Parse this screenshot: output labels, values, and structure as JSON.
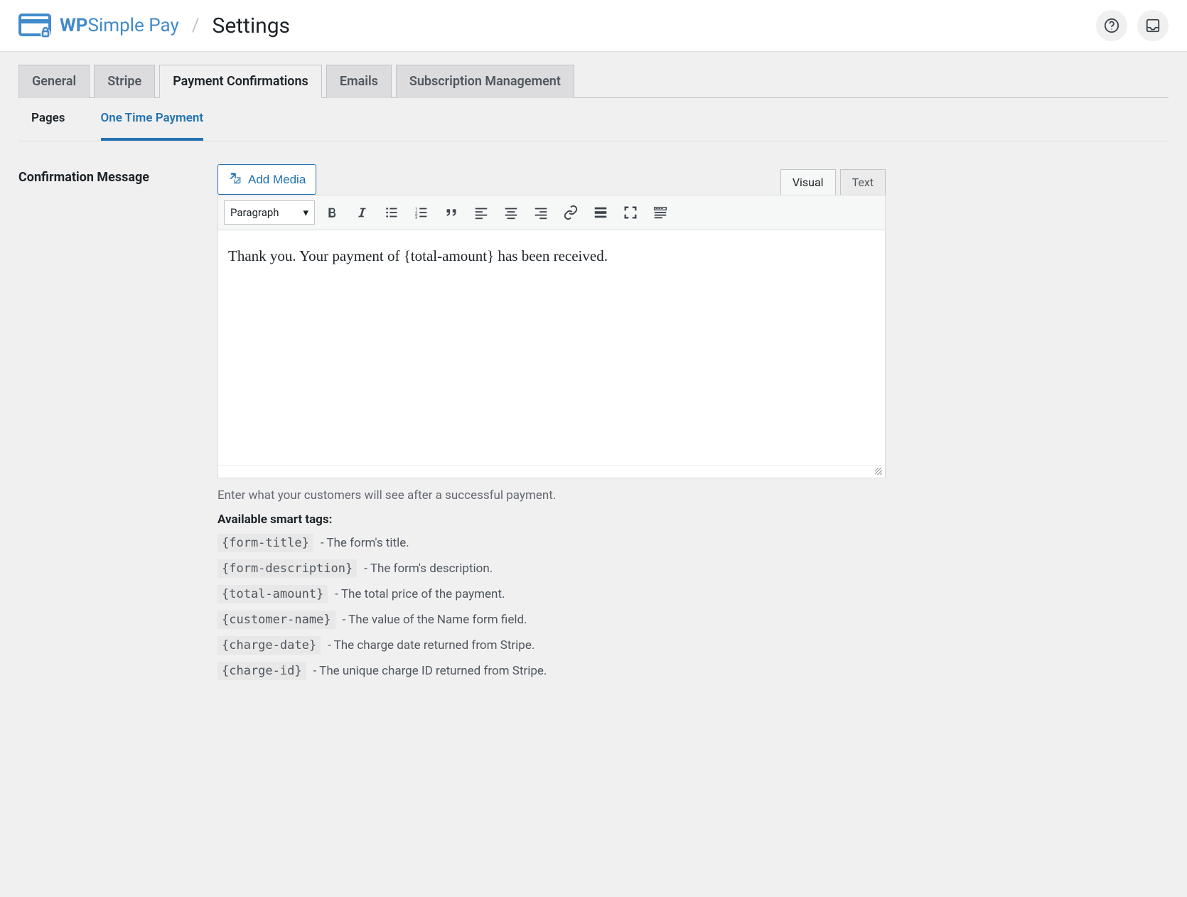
{
  "header": {
    "brand1": "WP",
    "brand2": "Simple Pay",
    "page_title": "Settings"
  },
  "tabs": [
    "General",
    "Stripe",
    "Payment Confirmations",
    "Emails",
    "Subscription Management"
  ],
  "active_tab": 2,
  "subtabs": [
    "Pages",
    "One Time Payment"
  ],
  "active_subtab": 1,
  "section": {
    "label": "Confirmation Message",
    "add_media": "Add Media",
    "editor_tabs": [
      "Visual",
      "Text"
    ],
    "active_editor_tab": 0,
    "format": "Paragraph",
    "body": "Thank you. Your payment of {total-amount} has been received.",
    "help": "Enter what your customers will see after a successful payment.",
    "smart_label": "Available smart tags:",
    "smart_tags": [
      {
        "tag": "{form-title}",
        "desc": " - The form's title."
      },
      {
        "tag": "{form-description}",
        "desc": " - The form's description."
      },
      {
        "tag": "{total-amount}",
        "desc": " - The total price of the payment."
      },
      {
        "tag": "{customer-name}",
        "desc": " - The value of the Name form field."
      },
      {
        "tag": "{charge-date}",
        "desc": " - The charge date returned from Stripe."
      },
      {
        "tag": "{charge-id}",
        "desc": " - The unique charge ID returned from Stripe."
      }
    ]
  }
}
